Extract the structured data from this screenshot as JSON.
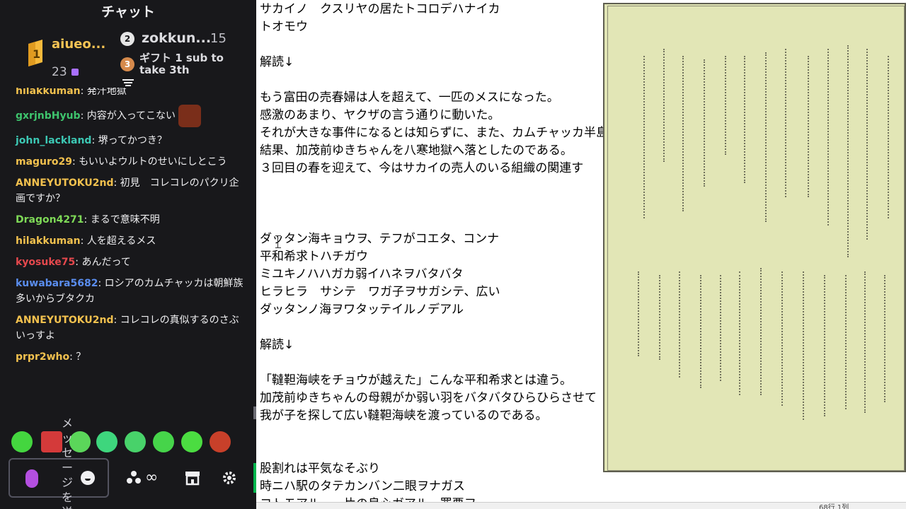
{
  "chat": {
    "title": "チャット",
    "leaderboard": {
      "first": {
        "name": "aiueo...",
        "count": "23"
      },
      "second": {
        "rank": "2",
        "name": "zokkun...",
        "count": "15"
      },
      "third": {
        "rank": "3",
        "text": "ギフト 1 sub to take 3th"
      }
    },
    "messages": [
      {
        "user": "hilakkuman",
        "user_color": "#f2c14e",
        "text": "発汗地獄"
      },
      {
        "user": "gxrjnbHyub",
        "user_color": "#3ec46d",
        "text": "内容が入ってこない",
        "emote": true
      },
      {
        "user": "john_lackland",
        "user_color": "#3cc8b4",
        "text": "堺ってかつき？"
      },
      {
        "user": "maguro29",
        "user_color": "#f2c14e",
        "text": "もいいよウルトのせいにしとこう"
      },
      {
        "user": "ANNEYUTOKU2nd",
        "user_color": "#f2c14e",
        "text": "初見　コレコレのパクリ企画ですか？"
      },
      {
        "user": "Dragon4271",
        "user_color": "#7ed957",
        "text": "まるで意味不明"
      },
      {
        "user": "hilakkuman",
        "user_color": "#f2c14e",
        "text": "人を超えるメス"
      },
      {
        "user": "kyosuke75",
        "user_color": "#e5484d",
        "text": "あんだって"
      },
      {
        "user": "kuwabara5682",
        "user_color": "#5a8dee",
        "text": "ロシアのカムチャッカは朝鮮族多いからブタクカ"
      },
      {
        "user": "ANNEYUTOKU2nd",
        "user_color": "#f2c14e",
        "text": "コレコレの真似するのさぶいっすよ"
      },
      {
        "user": "prpr2who",
        "user_color": "#f2c14e",
        "text": "？"
      }
    ],
    "input_vertical_text": "メッセージを送信",
    "icons": [
      "mic-icon",
      "emote-picker-icon",
      "channel-points-icon",
      "store-icon",
      "settings-icon"
    ]
  },
  "editor": {
    "lines": [
      "サカイノ　クスリヤの居たトコロデハナイカ",
      "トオモウ",
      "",
      "解読↓",
      "",
      "もう富田の売春婦は人を超えて、一匹のメスになった。",
      "感激のあまり、ヤクザの言う通りに動いた。",
      "それが大きな事件になるとは知らずに、また、カムチャッカ半島",
      "結果、加茂前ゆきちゃんを八寒地獄へ落としたのである。",
      "３回目の春を迎えて、今はサカイの売人のいる組織の関連す",
      "",
      "",
      "",
      "ダッタン海キョウヲ、テフがコエタ、コンナ",
      "平和希求トハチガウ",
      "ミユキノハハガカ弱イハネヲバタバタ",
      "ヒラヒラ　サシテ　ワガ子ヲサガシテ、広い",
      "ダッタンノ海ヲワタッテイルノデアル",
      "",
      "解読↓",
      "",
      "「韃靼海峡をチョウが越えた」こんな平和希求とは違う。",
      "加茂前ゆきちゃんの母親がか弱い羽をバタバタひらひらさせて",
      "我が子を探して広い韃靼海峡を渡っているのである。",
      "",
      "",
      "股割れは平気なそぶり",
      "時ニハ駅のタテカンバン二眼ヲナガス",
      "コトモアル　一片の良心ガアル　罪悪ヲ"
    ]
  },
  "status_bar": {
    "label": "68行 1列"
  }
}
